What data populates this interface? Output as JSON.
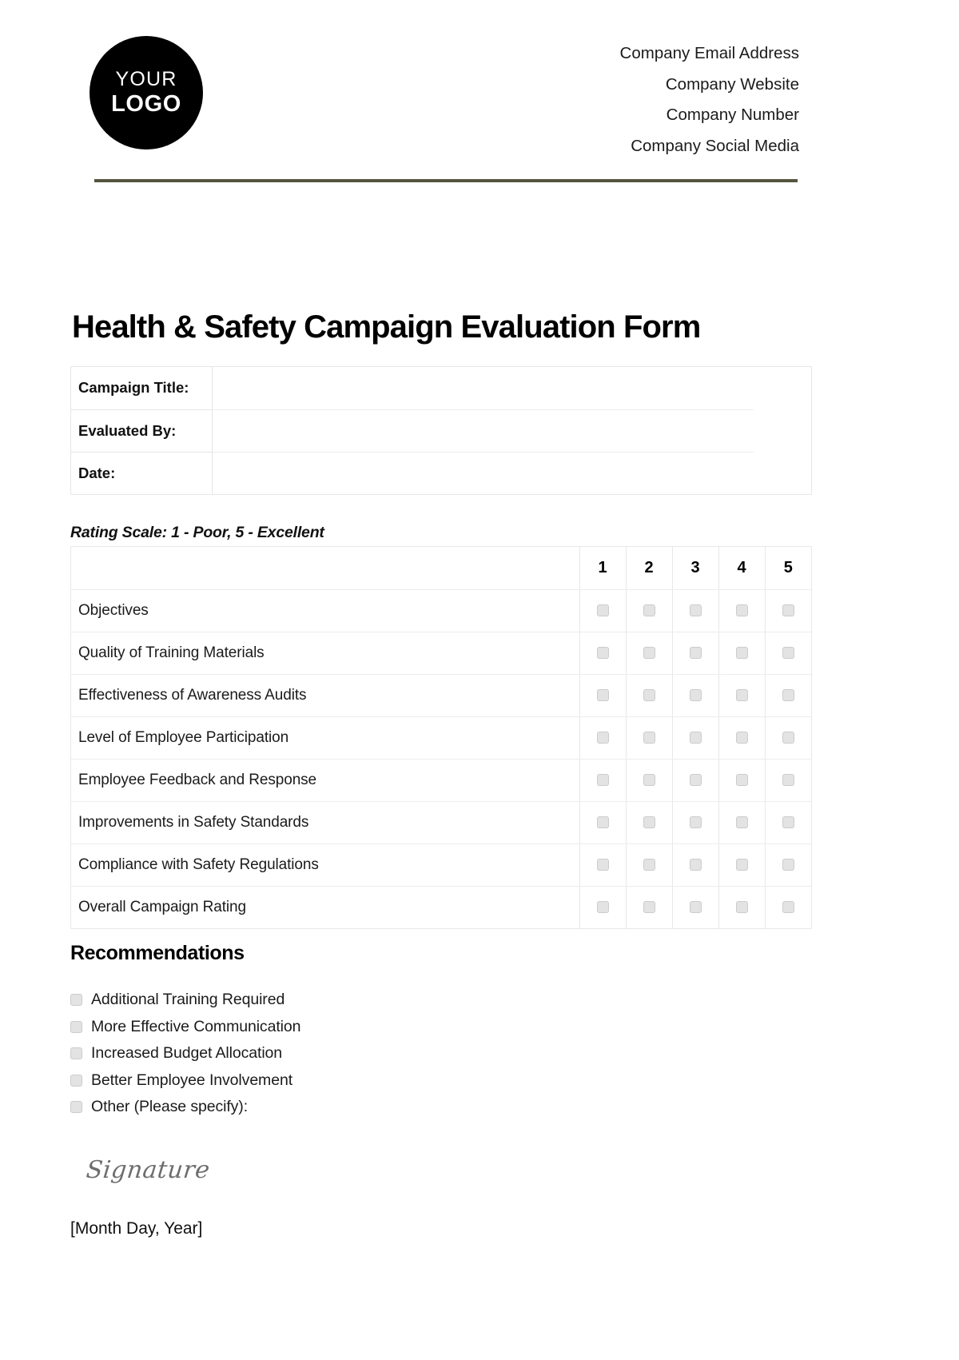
{
  "header": {
    "logo": {
      "line1": "YOUR",
      "line2": "LOGO"
    },
    "contact_lines": [
      "Company Email Address",
      "Company Website",
      "Company Number",
      "Company Social Media"
    ],
    "rule_color": "#55553f"
  },
  "title": "Health & Safety Campaign Evaluation Form",
  "info_table": {
    "rows": [
      {
        "label": "Campaign Title:",
        "value": ""
      },
      {
        "label": "Evaluated By:",
        "value": ""
      },
      {
        "label": "Date:",
        "value": ""
      }
    ]
  },
  "rating": {
    "scale_caption": "Rating Scale: 1 - Poor, 5 - Excellent",
    "columns": [
      "1",
      "2",
      "3",
      "4",
      "5"
    ],
    "criteria_header": "",
    "criteria": [
      "Objectives",
      "Quality of Training Materials",
      "Effectiveness of Awareness Audits",
      "Level of Employee Participation",
      "Employee Feedback and Response",
      "Improvements in Safety Standards",
      "Compliance with Safety Regulations",
      "Overall Campaign Rating"
    ]
  },
  "recommendations": {
    "heading": "Recommendations",
    "options": [
      "Additional Training Required",
      "More Effective Communication",
      "Increased Budget Allocation",
      "Better Employee Involvement",
      "Other (Please specify):"
    ]
  },
  "signature": {
    "label": "Signature",
    "date_placeholder": "[Month Day, Year]"
  }
}
